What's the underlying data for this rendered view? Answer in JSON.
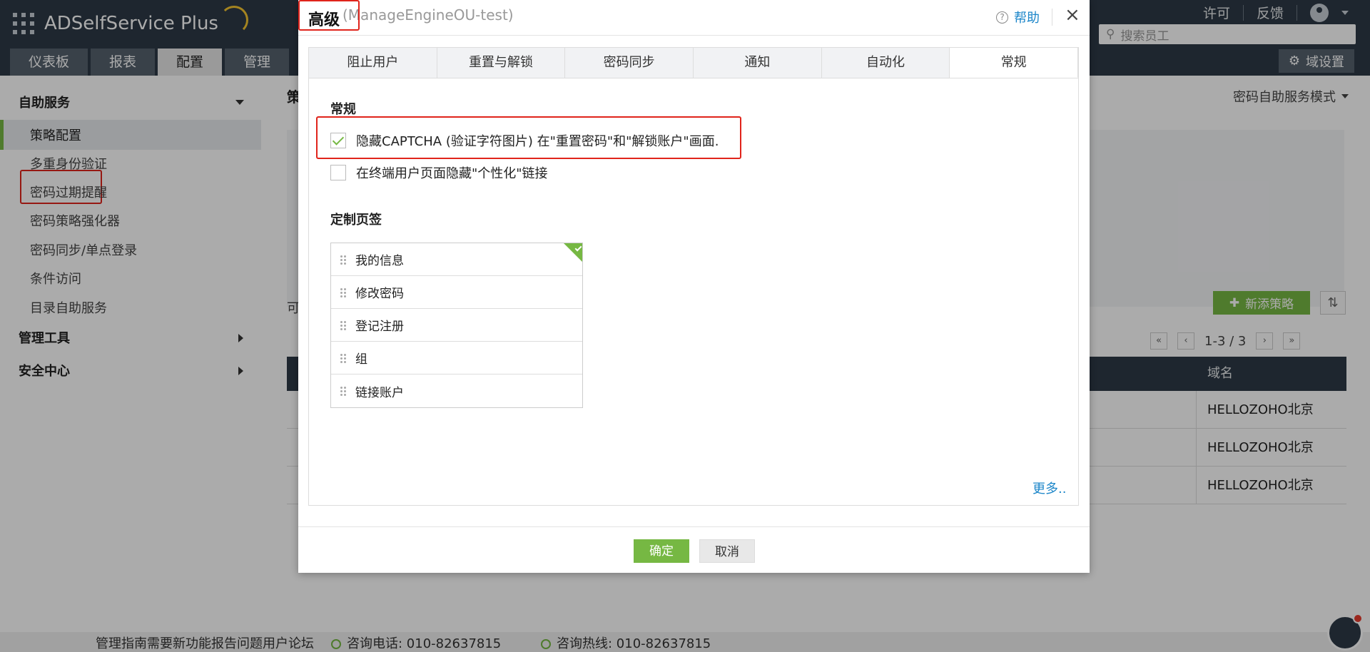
{
  "app": {
    "name": "ADSelfService Plus",
    "nav_tabs": [
      "仪表板",
      "报表",
      "配置",
      "管理"
    ],
    "active_tab": "配置",
    "top_links": [
      "许可",
      "反馈"
    ],
    "search_placeholder": "搜索员工",
    "domain_settings": "域设置"
  },
  "sidebar": {
    "sections": [
      {
        "label": "自助服务",
        "items": [
          "策略配置",
          "多重身份验证",
          "密码过期提醒",
          "密码策略强化器",
          "密码同步/单点登录",
          "条件访问",
          "目录自助服务"
        ]
      },
      {
        "label": "管理工具"
      },
      {
        "label": "安全中心"
      }
    ],
    "selected": "策略配置"
  },
  "main": {
    "title_partial": "策",
    "mode_switch": "密码自助服务模式",
    "list_label_partial": "可",
    "add_policy": "新添策略",
    "pagination": "1-3 / 3",
    "table": {
      "domain_header": "域名",
      "rows": [
        "HELLOZOHO北京",
        "HELLOZOHO北京",
        "HELLOZOHO北京"
      ]
    }
  },
  "footer": {
    "links": "管理指南需要新功能报告问题用户论坛",
    "phone": "咨询电话: 010-82637815",
    "hotline": "咨询热线: 010-82637815"
  },
  "modal": {
    "title": "高级",
    "subtitle": "(ManageEngineOU-test)",
    "help": "帮助",
    "close": "×",
    "tabs": [
      "阻止用户",
      "重置与解锁",
      "密码同步",
      "通知",
      "自动化",
      "常规"
    ],
    "active_tab": "常规",
    "general_section": "常规",
    "options": [
      {
        "label": "隐藏CAPTCHA (验证字符图片) 在\"重置密码\"和\"解锁账户\"画面.",
        "checked": true
      },
      {
        "label": "在终端用户页面隐藏\"个性化\"链接",
        "checked": false
      }
    ],
    "custom_tabs_section": "定制页签",
    "custom_tabs": [
      "我的信息",
      "修改密码",
      "登记注册",
      "组",
      "链接账户"
    ],
    "more": "更多..",
    "ok": "确定",
    "cancel": "取消"
  },
  "colors": {
    "accent_green": "#76b843",
    "header_dark": "#2d3a47",
    "highlight_red": "#e0241b",
    "link_blue": "#1c86c9"
  }
}
